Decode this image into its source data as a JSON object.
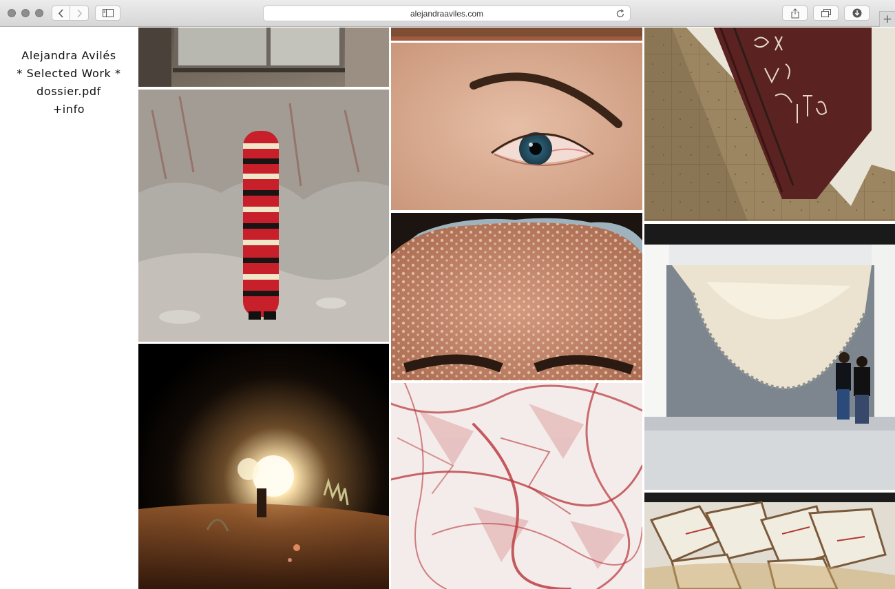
{
  "browser": {
    "url": "alejandraaviles.com",
    "new_tab_label": "+"
  },
  "site": {
    "artist_name": "Alejandra Avilés",
    "nav": {
      "selected_work": "* Selected Work *",
      "dossier": "dossier.pdf",
      "info": "+info"
    }
  },
  "gallery": {
    "items": [
      {
        "name": "window-photo"
      },
      {
        "name": "striped-costume-photo"
      },
      {
        "name": "night-light-photo"
      },
      {
        "name": "wood-strip-photo"
      },
      {
        "name": "eye-closeup-photo"
      },
      {
        "name": "forehead-closeup-photo"
      },
      {
        "name": "red-plastic-texture-photo"
      },
      {
        "name": "embroidered-textile-photo"
      },
      {
        "name": "fabric-installation-photo"
      },
      {
        "name": "crumpled-canvas-installation-photo"
      }
    ]
  },
  "colors": {
    "accent_red": "#c0282c",
    "chrome_bg": "#e1e1e1"
  }
}
